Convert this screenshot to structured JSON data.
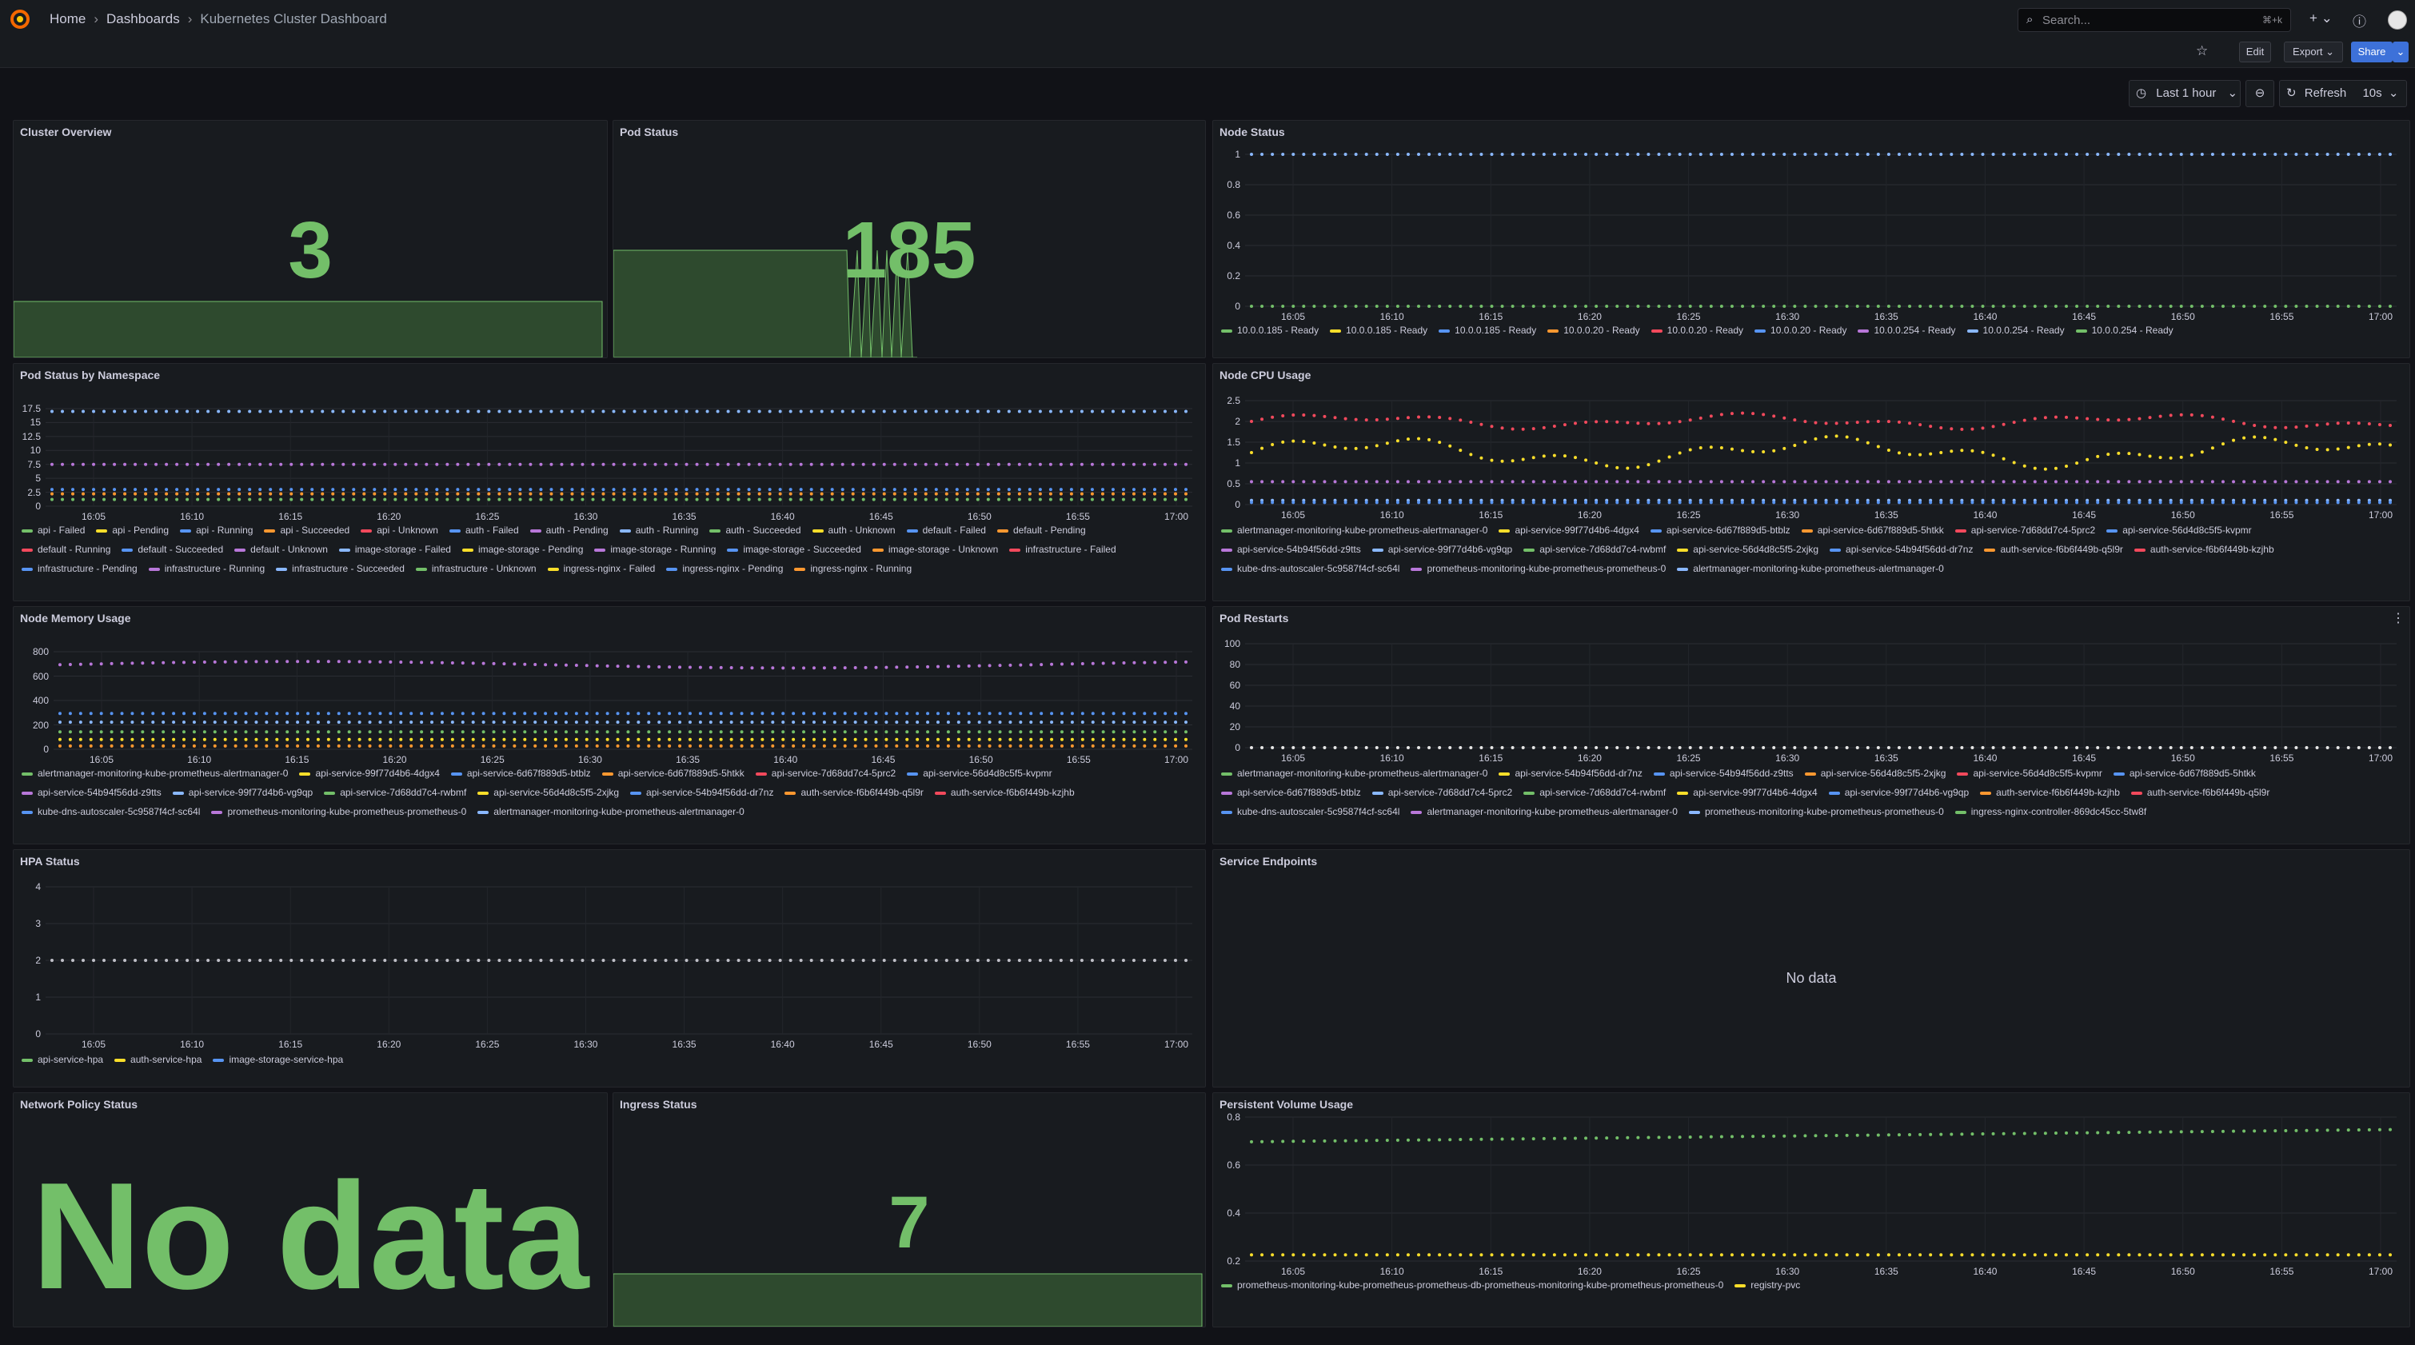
{
  "nav": {
    "breadcrumbs": [
      "Home",
      "Dashboards",
      "Kubernetes Cluster Dashboard"
    ]
  },
  "search": {
    "placeholder": "Search...",
    "shortcut": "⌘+k"
  },
  "toolbar": {
    "edit": "Edit",
    "export": "Export",
    "share": "Share"
  },
  "timepicker": {
    "range": "Last 1 hour",
    "refresh": "Refresh",
    "interval": "10s"
  },
  "colors": {
    "green": "#73bf69",
    "yellow": "#fade2a",
    "blue": "#5794f2",
    "orange": "#ff9830",
    "red": "#f2495c",
    "purple": "#b877d9"
  },
  "time_ticks": [
    "16:05",
    "16:10",
    "16:15",
    "16:20",
    "16:25",
    "16:30",
    "16:35",
    "16:40",
    "16:45",
    "16:50",
    "16:55",
    "17:00"
  ],
  "panels": {
    "cluster_overview": {
      "title": "Cluster Overview",
      "value": "3"
    },
    "pod_status": {
      "title": "Pod Status",
      "value": "185"
    },
    "node_status": {
      "title": "Node Status",
      "y_ticks": [
        "1",
        "0.8",
        "0.6",
        "0.4",
        "0.2",
        "0"
      ],
      "legend": [
        {
          "label": "10.0.0.185 - Ready",
          "color": "#73bf69"
        },
        {
          "label": "10.0.0.185 - Ready",
          "color": "#fade2a"
        },
        {
          "label": "10.0.0.185 - Ready",
          "color": "#5794f2"
        },
        {
          "label": "10.0.0.20 - Ready",
          "color": "#ff9830"
        },
        {
          "label": "10.0.0.20 - Ready",
          "color": "#f2495c"
        },
        {
          "label": "10.0.0.20 - Ready",
          "color": "#5794f2"
        },
        {
          "label": "10.0.0.254 - Ready",
          "color": "#b877d9"
        },
        {
          "label": "10.0.0.254 - Ready",
          "color": "#8ab8ff"
        },
        {
          "label": "10.0.0.254 - Ready",
          "color": "#73bf69"
        }
      ]
    },
    "pod_by_ns": {
      "title": "Pod Status by Namespace",
      "y_ticks": [
        "17.5",
        "15",
        "12.5",
        "10",
        "7.5",
        "5",
        "2.5",
        "0"
      ],
      "legend": [
        {
          "label": "api - Failed",
          "color": "#73bf69"
        },
        {
          "label": "api - Pending",
          "color": "#fade2a"
        },
        {
          "label": "api - Running",
          "color": "#5794f2"
        },
        {
          "label": "api - Succeeded",
          "color": "#ff9830"
        },
        {
          "label": "api - Unknown",
          "color": "#f2495c"
        },
        {
          "label": "auth - Failed",
          "color": "#5794f2"
        },
        {
          "label": "auth - Pending",
          "color": "#b877d9"
        },
        {
          "label": "auth - Running",
          "color": "#8ab8ff"
        },
        {
          "label": "auth - Succeeded",
          "color": "#73bf69"
        },
        {
          "label": "auth - Unknown",
          "color": "#fade2a"
        },
        {
          "label": "default - Failed",
          "color": "#5794f2"
        },
        {
          "label": "default - Pending",
          "color": "#ff9830"
        },
        {
          "label": "default - Running",
          "color": "#f2495c"
        },
        {
          "label": "default - Succeeded",
          "color": "#5794f2"
        },
        {
          "label": "default - Unknown",
          "color": "#b877d9"
        },
        {
          "label": "image-storage - Failed",
          "color": "#8ab8ff"
        },
        {
          "label": "image-storage - Pending",
          "color": "#fade2a"
        },
        {
          "label": "image-storage - Running",
          "color": "#b877d9"
        },
        {
          "label": "image-storage - Succeeded",
          "color": "#5794f2"
        },
        {
          "label": "image-storage - Unknown",
          "color": "#ff9830"
        },
        {
          "label": "infrastructure - Failed",
          "color": "#f2495c"
        },
        {
          "label": "infrastructure - Pending",
          "color": "#5794f2"
        },
        {
          "label": "infrastructure - Running",
          "color": "#b877d9"
        },
        {
          "label": "infrastructure - Succeeded",
          "color": "#8ab8ff"
        },
        {
          "label": "infrastructure - Unknown",
          "color": "#73bf69"
        },
        {
          "label": "ingress-nginx - Failed",
          "color": "#fade2a"
        },
        {
          "label": "ingress-nginx - Pending",
          "color": "#5794f2"
        },
        {
          "label": "ingress-nginx - Running",
          "color": "#ff9830"
        }
      ]
    },
    "node_cpu": {
      "title": "Node CPU Usage",
      "y_ticks": [
        "2.5",
        "2",
        "1.5",
        "1",
        "0.5",
        "0"
      ],
      "legend": [
        {
          "label": "alertmanager-monitoring-kube-prometheus-alertmanager-0",
          "color": "#73bf69"
        },
        {
          "label": "api-service-99f77d4b6-4dgx4",
          "color": "#fade2a"
        },
        {
          "label": "api-service-6d67f889d5-btblz",
          "color": "#5794f2"
        },
        {
          "label": "api-service-6d67f889d5-5htkk",
          "color": "#ff9830"
        },
        {
          "label": "api-service-7d68dd7c4-5prc2",
          "color": "#f2495c"
        },
        {
          "label": "api-service-56d4d8c5f5-kvpmr",
          "color": "#5794f2"
        },
        {
          "label": "api-service-54b94f56dd-z9tts",
          "color": "#b877d9"
        },
        {
          "label": "api-service-99f77d4b6-vg9qp",
          "color": "#8ab8ff"
        },
        {
          "label": "api-service-7d68dd7c4-rwbmf",
          "color": "#73bf69"
        },
        {
          "label": "api-service-56d4d8c5f5-2xjkg",
          "color": "#fade2a"
        },
        {
          "label": "api-service-54b94f56dd-dr7nz",
          "color": "#5794f2"
        },
        {
          "label": "auth-service-f6b6f449b-q5l9r",
          "color": "#ff9830"
        },
        {
          "label": "auth-service-f6b6f449b-kzjhb",
          "color": "#f2495c"
        },
        {
          "label": "kube-dns-autoscaler-5c9587f4cf-sc64l",
          "color": "#5794f2"
        },
        {
          "label": "prometheus-monitoring-kube-prometheus-prometheus-0",
          "color": "#b877d9"
        },
        {
          "label": "alertmanager-monitoring-kube-prometheus-alertmanager-0",
          "color": "#8ab8ff"
        }
      ]
    },
    "node_mem": {
      "title": "Node Memory Usage",
      "y_ticks": [
        "800",
        "600",
        "400",
        "200",
        "0"
      ],
      "legend": [
        {
          "label": "alertmanager-monitoring-kube-prometheus-alertmanager-0",
          "color": "#73bf69"
        },
        {
          "label": "api-service-99f77d4b6-4dgx4",
          "color": "#fade2a"
        },
        {
          "label": "api-service-6d67f889d5-btblz",
          "color": "#5794f2"
        },
        {
          "label": "api-service-6d67f889d5-5htkk",
          "color": "#ff9830"
        },
        {
          "label": "api-service-7d68dd7c4-5prc2",
          "color": "#f2495c"
        },
        {
          "label": "api-service-56d4d8c5f5-kvpmr",
          "color": "#5794f2"
        },
        {
          "label": "api-service-54b94f56dd-z9tts",
          "color": "#b877d9"
        },
        {
          "label": "api-service-99f77d4b6-vg9qp",
          "color": "#8ab8ff"
        },
        {
          "label": "api-service-7d68dd7c4-rwbmf",
          "color": "#73bf69"
        },
        {
          "label": "api-service-56d4d8c5f5-2xjkg",
          "color": "#fade2a"
        },
        {
          "label": "api-service-54b94f56dd-dr7nz",
          "color": "#5794f2"
        },
        {
          "label": "auth-service-f6b6f449b-q5l9r",
          "color": "#ff9830"
        },
        {
          "label": "auth-service-f6b6f449b-kzjhb",
          "color": "#f2495c"
        },
        {
          "label": "kube-dns-autoscaler-5c9587f4cf-sc64l",
          "color": "#5794f2"
        },
        {
          "label": "prometheus-monitoring-kube-prometheus-prometheus-0",
          "color": "#b877d9"
        },
        {
          "label": "alertmanager-monitoring-kube-prometheus-alertmanager-0",
          "color": "#8ab8ff"
        }
      ]
    },
    "pod_restarts": {
      "title": "Pod Restarts",
      "y_ticks": [
        "100",
        "80",
        "60",
        "40",
        "20",
        "0"
      ],
      "legend": [
        {
          "label": "alertmanager-monitoring-kube-prometheus-alertmanager-0",
          "color": "#73bf69"
        },
        {
          "label": "api-service-54b94f56dd-dr7nz",
          "color": "#fade2a"
        },
        {
          "label": "api-service-54b94f56dd-z9tts",
          "color": "#5794f2"
        },
        {
          "label": "api-service-56d4d8c5f5-2xjkg",
          "color": "#ff9830"
        },
        {
          "label": "api-service-56d4d8c5f5-kvpmr",
          "color": "#f2495c"
        },
        {
          "label": "api-service-6d67f889d5-5htkk",
          "color": "#5794f2"
        },
        {
          "label": "api-service-6d67f889d5-btblz",
          "color": "#b877d9"
        },
        {
          "label": "api-service-7d68dd7c4-5prc2",
          "color": "#8ab8ff"
        },
        {
          "label": "api-service-7d68dd7c4-rwbmf",
          "color": "#73bf69"
        },
        {
          "label": "api-service-99f77d4b6-4dgx4",
          "color": "#fade2a"
        },
        {
          "label": "api-service-99f77d4b6-vg9qp",
          "color": "#5794f2"
        },
        {
          "label": "auth-service-f6b6f449b-kzjhb",
          "color": "#ff9830"
        },
        {
          "label": "auth-service-f6b6f449b-q5l9r",
          "color": "#f2495c"
        },
        {
          "label": "kube-dns-autoscaler-5c9587f4cf-sc64l",
          "color": "#5794f2"
        },
        {
          "label": "alertmanager-monitoring-kube-prometheus-alertmanager-0",
          "color": "#b877d9"
        },
        {
          "label": "prometheus-monitoring-kube-prometheus-prometheus-0",
          "color": "#8ab8ff"
        },
        {
          "label": "ingress-nginx-controller-869dc45cc-5tw8f",
          "color": "#73bf69"
        }
      ]
    },
    "hpa": {
      "title": "HPA Status",
      "y_ticks": [
        "4",
        "3",
        "2",
        "1",
        "0"
      ],
      "legend": [
        {
          "label": "api-service-hpa",
          "color": "#73bf69"
        },
        {
          "label": "auth-service-hpa",
          "color": "#fade2a"
        },
        {
          "label": "image-storage-service-hpa",
          "color": "#5794f2"
        }
      ]
    },
    "endpoints": {
      "title": "Service Endpoints",
      "nodata": "No data"
    },
    "netpol": {
      "title": "Network Policy Status",
      "nodata": "No data"
    },
    "ingress": {
      "title": "Ingress Status",
      "value": "7"
    },
    "pv": {
      "title": "Persistent Volume Usage",
      "y_ticks": [
        "0.8",
        "0.6",
        "0.4",
        "0.2"
      ],
      "legend": [
        {
          "label": "prometheus-monitoring-kube-prometheus-prometheus-db-prometheus-monitoring-kube-prometheus-prometheus-0",
          "color": "#73bf69"
        },
        {
          "label": "registry-pvc",
          "color": "#fade2a"
        }
      ]
    }
  },
  "chart_data": [
    {
      "type": "line",
      "title": "Node Status",
      "ylim": [
        0,
        1
      ],
      "series": [
        {
          "name": "10.0.0.185 - Ready",
          "values": [
            1,
            1
          ]
        },
        {
          "name": "10.0.0.254 - Ready",
          "values": [
            0,
            0
          ]
        }
      ]
    },
    {
      "type": "line",
      "title": "Pod Status by Namespace",
      "ylim": [
        0,
        17.5
      ],
      "series": [
        {
          "name": "ingress-nginx - Running",
          "values": [
            17,
            17
          ]
        },
        {
          "name": "image-storage - Running",
          "values": [
            7.5,
            7.5
          ]
        },
        {
          "name": "api - Running",
          "values": [
            2.5,
            2.5
          ]
        }
      ]
    },
    {
      "type": "line",
      "title": "Node CPU Usage",
      "ylim": [
        0,
        2.5
      ],
      "series": [
        {
          "name": "api-service-7d68dd7c4-5prc2",
          "values": [
            2.0,
            2.1
          ]
        },
        {
          "name": "api-service-99f77d4b6-4dgx4",
          "values": [
            1.3,
            1.4
          ]
        }
      ]
    },
    {
      "type": "line",
      "title": "Node Memory Usage",
      "ylim": [
        0,
        900
      ],
      "series": [
        {
          "name": "api-service-54b94f56dd-z9tts",
          "values": [
            780,
            810
          ]
        },
        {
          "name": "api-service-6d67f889d5-btblz",
          "values": [
            330,
            330
          ]
        }
      ]
    },
    {
      "type": "line",
      "title": "Pod Restarts",
      "ylim": [
        0,
        100
      ],
      "series": [
        {
          "name": "api-service-99f77d4b6-4dgx4",
          "values": [
            0,
            0
          ]
        }
      ]
    },
    {
      "type": "line",
      "title": "HPA Status",
      "ylim": [
        0,
        4
      ],
      "series": [
        {
          "name": "api-service-hpa",
          "values": [
            2,
            2
          ]
        }
      ]
    },
    {
      "type": "line",
      "title": "Persistent Volume Usage",
      "ylim": [
        0.2,
        0.9
      ],
      "series": [
        {
          "name": "prometheus-monitoring-kube-prometheus-prometheus-db-prometheus-monitoring-kube-prometheus-prometheus-0",
          "values": [
            0.78,
            0.84
          ]
        },
        {
          "name": "registry-pvc",
          "values": [
            0.23,
            0.23
          ]
        }
      ]
    }
  ]
}
